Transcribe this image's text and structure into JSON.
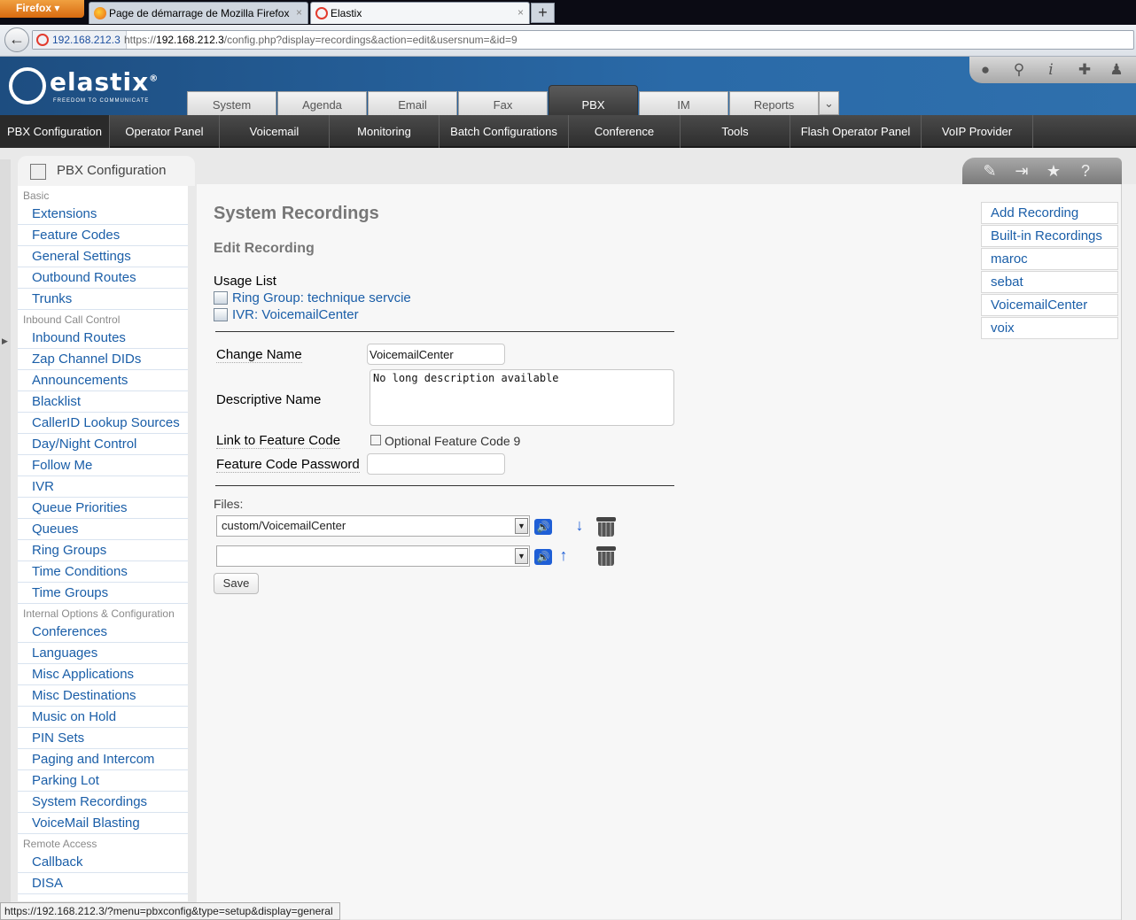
{
  "browser": {
    "app_button": "Firefox",
    "tabs": [
      {
        "title": "Page de démarrage de Mozilla Firefox",
        "active": false
      },
      {
        "title": "Elastix",
        "active": true
      }
    ],
    "new_tab": "+",
    "url_host": "192.168.212.3",
    "url_prefix": "https://",
    "url_host_bold": "192.168.212.3",
    "url_rest": "/config.php?display=recordings&action=edit&usersnum=&id=9",
    "status_url": "https://192.168.212.3/?menu=pbxconfig&type=setup&display=general"
  },
  "brand": {
    "name": "elastix",
    "registered": "®",
    "tagline": "FREEDOM TO COMMUNICATE"
  },
  "main_tabs": [
    "System",
    "Agenda",
    "Email",
    "Fax",
    "PBX",
    "IM",
    "Reports"
  ],
  "active_main_tab": "PBX",
  "submenu": [
    "PBX Configuration",
    "Operator Panel",
    "Voicemail",
    "Monitoring",
    "Batch Configurations",
    "Conference",
    "Tools",
    "Flash Operator Panel",
    "VoIP Provider"
  ],
  "sidebar": {
    "title": "PBX Configuration",
    "sections": [
      {
        "label": "Basic",
        "items": [
          "Extensions",
          "Feature Codes",
          "General Settings",
          "Outbound Routes",
          "Trunks"
        ]
      },
      {
        "label": "Inbound Call Control",
        "items": [
          "Inbound Routes",
          "Zap Channel DIDs",
          "Announcements",
          "Blacklist",
          "CallerID Lookup Sources",
          "Day/Night Control",
          "Follow Me",
          "IVR",
          "Queue Priorities",
          "Queues",
          "Ring Groups",
          "Time Conditions",
          "Time Groups"
        ]
      },
      {
        "label": "Internal Options & Configuration",
        "items": [
          "Conferences",
          "Languages",
          "Misc Applications",
          "Misc Destinations",
          "Music on Hold",
          "PIN Sets",
          "Paging and Intercom",
          "Parking Lot",
          "System Recordings",
          "VoiceMail Blasting"
        ]
      },
      {
        "label": "Remote Access",
        "items": [
          "Callback",
          "DISA"
        ]
      }
    ]
  },
  "content": {
    "title": "System Recordings",
    "subtitle": "Edit Recording",
    "usage_label": "Usage List",
    "usage_links": [
      "Ring Group: technique servcie",
      "IVR: VoicemailCenter"
    ],
    "change_name_label": "Change Name",
    "change_name_value": "VoicemailCenter",
    "descriptive_name_label": "Descriptive Name",
    "descriptive_name_value": "No long description available",
    "link_feature_label": "Link to Feature Code",
    "optional_feature_label": "Optional Feature Code 9",
    "feature_password_label": "Feature Code Password",
    "feature_password_value": "",
    "files_label": "Files:",
    "file_1": "custom/VoicemailCenter",
    "file_2": "",
    "save_label": "Save"
  },
  "recordings_panel": [
    "Add Recording",
    "Built-in Recordings",
    "maroc",
    "sebat",
    "VoicemailCenter",
    "voix"
  ]
}
